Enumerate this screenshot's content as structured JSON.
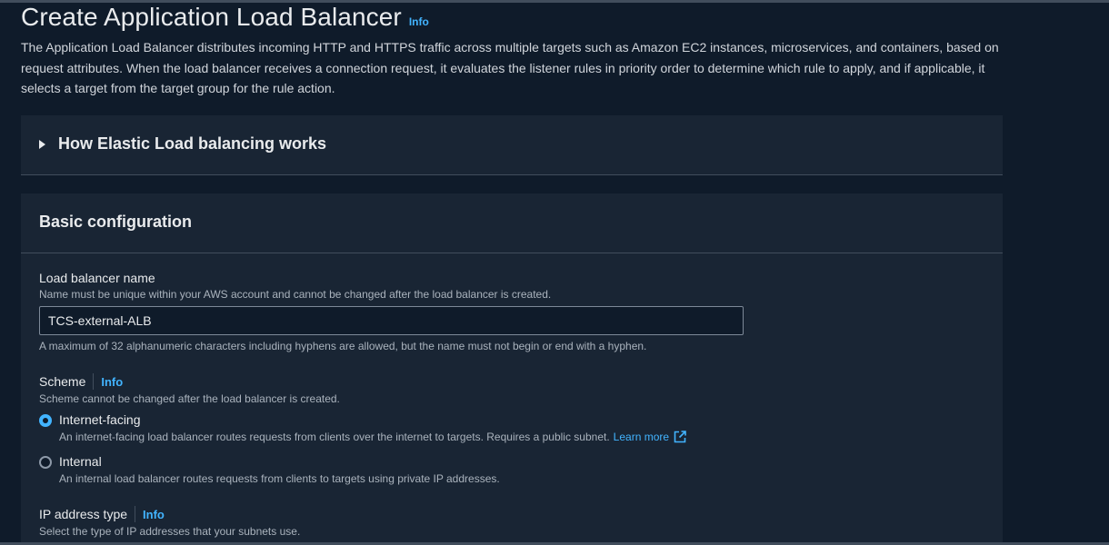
{
  "header": {
    "title": "Create Application Load Balancer",
    "info": "Info",
    "description": "The Application Load Balancer distributes incoming HTTP and HTTPS traffic across multiple targets such as Amazon EC2 instances, microservices, and containers, based on request attributes. When the load balancer receives a connection request, it evaluates the listener rules in priority order to determine which rule to apply, and if applicable, it selects a target from the target group for the rule action."
  },
  "how_it_works": {
    "label": "How Elastic Load balancing works"
  },
  "basic_config": {
    "title": "Basic configuration",
    "name_field": {
      "label": "Load balancer name",
      "description": "Name must be unique within your AWS account and cannot be changed after the load balancer is created.",
      "value": "TCS-external-ALB",
      "constraint": "A maximum of 32 alphanumeric characters including hyphens are allowed, but the name must not begin or end with a hyphen."
    },
    "scheme": {
      "label": "Scheme",
      "info": "Info",
      "description": "Scheme cannot be changed after the load balancer is created.",
      "options": [
        {
          "label": "Internet-facing",
          "description": "An internet-facing load balancer routes requests from clients over the internet to targets. Requires a public subnet.",
          "link": "Learn more",
          "selected": true
        },
        {
          "label": "Internal",
          "description": "An internal load balancer routes requests from clients to targets using private IP addresses.",
          "selected": false
        }
      ]
    },
    "ip_type": {
      "label": "IP address type",
      "info": "Info",
      "description": "Select the type of IP addresses that your subnets use."
    }
  },
  "colors": {
    "background": "#0f1b2a",
    "panel": "#192534",
    "accent": "#42b4ff",
    "text": "#e9ebed",
    "muted": "#aab3bd"
  },
  "icons": {
    "caret": "caret-right-icon",
    "external": "external-link-icon"
  }
}
